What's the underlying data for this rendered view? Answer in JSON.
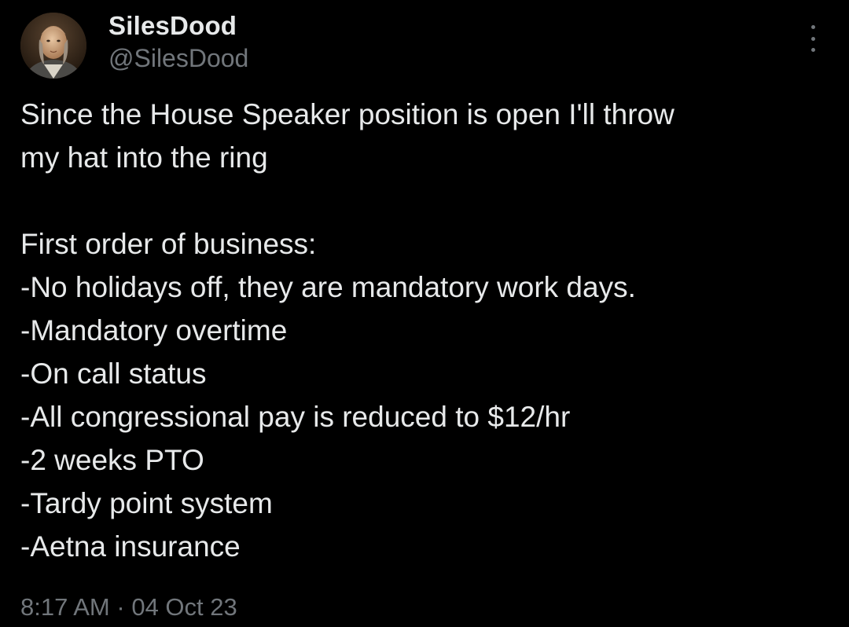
{
  "author": {
    "display_name": "SilesDood",
    "handle": "@SilesDood",
    "avatar_icon": "portrait-avatar"
  },
  "menu": {
    "icon": "more-vertical-icon"
  },
  "tweet": {
    "intro_lines": [
      "Since the House Speaker position is open I'll throw",
      "my hat into the ring"
    ],
    "list_heading": "First order of business:",
    "items": [
      "-No holidays off, they are mandatory work days.",
      "-Mandatory overtime",
      "-On call status",
      "-All congressional pay is reduced to $12/hr",
      "-2 weeks PTO",
      "-Tardy point system",
      "-Aetna insurance"
    ]
  },
  "meta": {
    "time": "8:17 AM",
    "separator": "·",
    "date": "04 Oct 23"
  },
  "colors": {
    "background": "#000000",
    "primary_text": "#e7e9ea",
    "secondary_text": "#71767b"
  }
}
